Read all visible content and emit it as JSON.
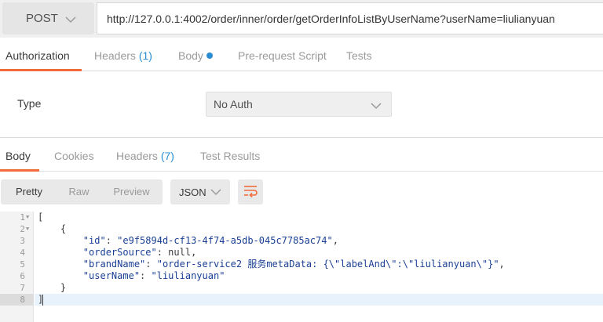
{
  "request": {
    "method": "POST",
    "url": "http://127.0.0.1:4002/order/inner/order/getOrderInfoListByUserName?userName=liulianyuan"
  },
  "request_tabs": {
    "authorization": "Authorization",
    "headers": "Headers",
    "headers_count": "(1)",
    "body": "Body",
    "prerequest": "Pre-request Script",
    "tests": "Tests"
  },
  "auth": {
    "type_label": "Type",
    "selected": "No Auth"
  },
  "response_tabs": {
    "body": "Body",
    "cookies": "Cookies",
    "headers": "Headers",
    "headers_count": "(7)",
    "test_results": "Test Results"
  },
  "toolbar": {
    "pretty": "Pretty",
    "raw": "Raw",
    "preview": "Preview",
    "format": "JSON"
  },
  "icons": {
    "method_dropdown": "chevron-down-icon",
    "auth_dropdown": "chevron-down-icon",
    "format_dropdown": "chevron-down-icon",
    "wrap": "wrap-lines-icon",
    "fold": "fold-arrow-icon"
  },
  "colors": {
    "accent": "#f26b3a",
    "link": "#2a8dd4",
    "code": "#1a3f94"
  },
  "code": {
    "line_numbers": [
      "1",
      "2",
      "3",
      "4",
      "5",
      "6",
      "7",
      "8"
    ],
    "lines": {
      "l1": "[",
      "l2": "    {",
      "l3_key": "\"id\"",
      "l3_val": "\"e9f5894d-cf13-4f74-a5db-045c7785ac74\"",
      "l4_key": "\"orderSource\"",
      "l4_val": "null",
      "l5_key": "\"brandName\"",
      "l5_val": "\"order-service2 服务metaData: {\\\"labelAnd\\\":\\\"liulianyuan\\\"}\"",
      "l6_key": "\"userName\"",
      "l6_val": "\"liulianyuan\"",
      "l7": "    }",
      "l8": "]"
    }
  }
}
